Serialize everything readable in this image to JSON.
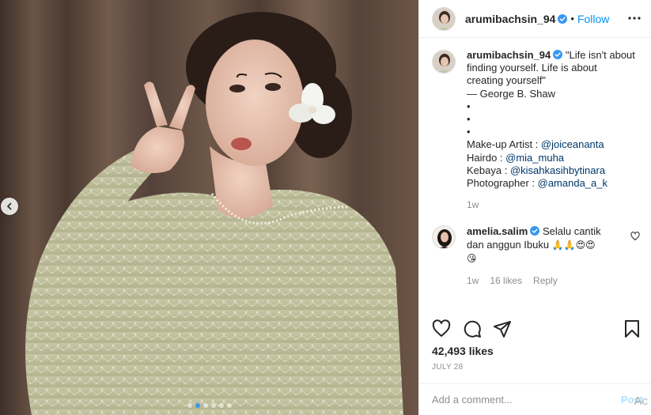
{
  "header": {
    "username": "arumibachsin_94",
    "separator": "•",
    "follow_label": "Follow"
  },
  "caption": {
    "username": "arumibachsin_94",
    "lines": [
      "\"Life isn't about",
      "finding yourself. Life is about",
      "creating yourself\"",
      "— George B. Shaw",
      "•",
      "•",
      "•"
    ],
    "credits": [
      {
        "label": "Make-up Artist : ",
        "mention": "@joiceananta"
      },
      {
        "label": "Hairdo : ",
        "mention": "@mia_muha"
      },
      {
        "label": "Kebaya : ",
        "mention": "@kisahkasihbytinara"
      },
      {
        "label": "Photographer : ",
        "mention": "@amanda_a_k"
      }
    ],
    "time": "1w"
  },
  "comment": {
    "username": "amelia.salim",
    "text_1": "Selalu cantik",
    "text_2": "dan anggun Ibuku",
    "emoji_1": "🙏🙏😍😍",
    "emoji_2": "😘",
    "time": "1w",
    "likes": "16 likes",
    "reply_label": "Reply"
  },
  "post": {
    "likes": "42,493 likes",
    "date": "JULY 28"
  },
  "add_comment": {
    "placeholder": "Add a comment...",
    "post_label": "Post",
    "watermark": "Ac"
  },
  "icons": {
    "verified": "verified-badge-icon",
    "more": "more-options-icon",
    "like": "heart-icon",
    "comment": "comment-bubble-icon",
    "share": "paper-plane-icon",
    "save": "bookmark-icon",
    "carousel_prev": "chevron-left-icon"
  },
  "colors": {
    "accent": "#0095f6",
    "verified": "#3897f0",
    "mention": "#00376b",
    "muted": "#8e8e8e"
  },
  "carousel": {
    "count": 6,
    "active_index": 1
  }
}
